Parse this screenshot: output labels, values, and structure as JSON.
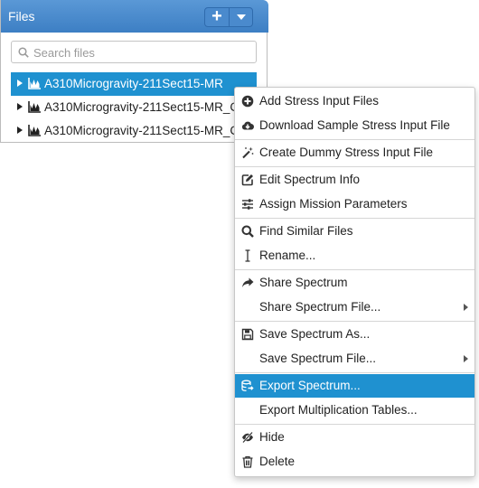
{
  "panel": {
    "title": "Files",
    "add_label": "+",
    "search_placeholder": "Search files"
  },
  "files": [
    {
      "name": "A310Microgravity-211Sect15-MR",
      "selected": true
    },
    {
      "name": "A310Microgravity-211Sect15-MR_C",
      "selected": false
    },
    {
      "name": "A310Microgravity-211Sect15-MR_C",
      "selected": false
    }
  ],
  "menu": {
    "items": [
      {
        "label": "Add Stress Input Files",
        "icon": "plus-circle-icon"
      },
      {
        "label": "Download Sample Stress Input File",
        "icon": "cloud-download-icon"
      },
      {
        "label": "Create Dummy Stress Input File",
        "icon": "magic-wand-icon"
      },
      {
        "label": "Edit Spectrum Info",
        "icon": "edit-icon"
      },
      {
        "label": "Assign Mission Parameters",
        "icon": "sliders-icon"
      },
      {
        "label": "Find Similar Files",
        "icon": "search-icon"
      },
      {
        "label": "Rename...",
        "icon": "text-cursor-icon"
      },
      {
        "label": "Share Spectrum",
        "icon": "share-arrow-icon"
      },
      {
        "label": "Share Spectrum File...",
        "icon": "",
        "submenu": true
      },
      {
        "label": "Save Spectrum As...",
        "icon": "floppy-disk-icon"
      },
      {
        "label": "Save Spectrum File...",
        "icon": "",
        "submenu": true
      },
      {
        "label": "Export Spectrum...",
        "icon": "database-export-icon",
        "highlighted": true
      },
      {
        "label": "Export Multiplication Tables...",
        "icon": ""
      },
      {
        "label": "Hide",
        "icon": "eye-slash-icon"
      },
      {
        "label": "Delete",
        "icon": "trash-icon"
      }
    ]
  },
  "colors": {
    "header_blue": "#3d7fc4",
    "selection_blue": "#1f91d0"
  }
}
